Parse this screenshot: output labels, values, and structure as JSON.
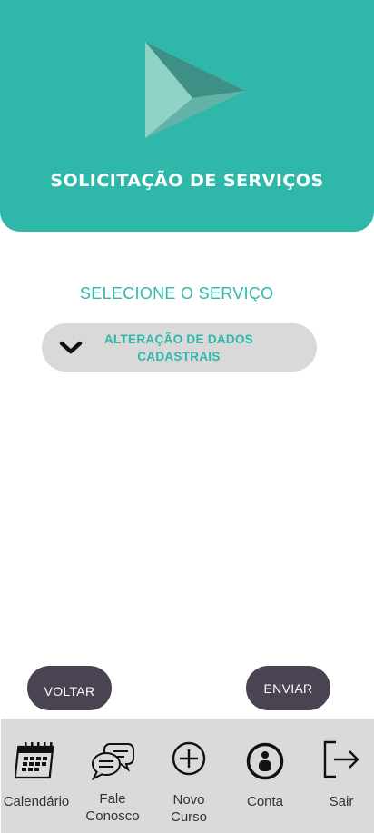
{
  "header": {
    "title": "SOLICITAÇÃO DE SERVIÇOS"
  },
  "form": {
    "label": "SELECIONE O SERVIÇO",
    "select_value_line1": "ALTERAÇÃO DE DADOS",
    "select_value_line2": "CADASTRAIS"
  },
  "actions": {
    "back_label": "VOLTAR",
    "submit_label": "ENVIAR"
  },
  "nav": {
    "items": [
      {
        "label": "Calendário",
        "icon": "calendar-icon"
      },
      {
        "label_line1": "Fale",
        "label_line2": "Conosco",
        "icon": "chat-bubbles-icon"
      },
      {
        "label_line1": "Novo",
        "label_line2": "Curso",
        "icon": "plus-circle-icon"
      },
      {
        "label": "Conta",
        "icon": "account-icon"
      },
      {
        "label": "Sair",
        "icon": "logout-icon"
      }
    ]
  },
  "colors": {
    "accent": "#2fb8a9",
    "button": "#4a4452",
    "select_bg": "#d9d9d9",
    "nav_bg": "#dadada"
  }
}
